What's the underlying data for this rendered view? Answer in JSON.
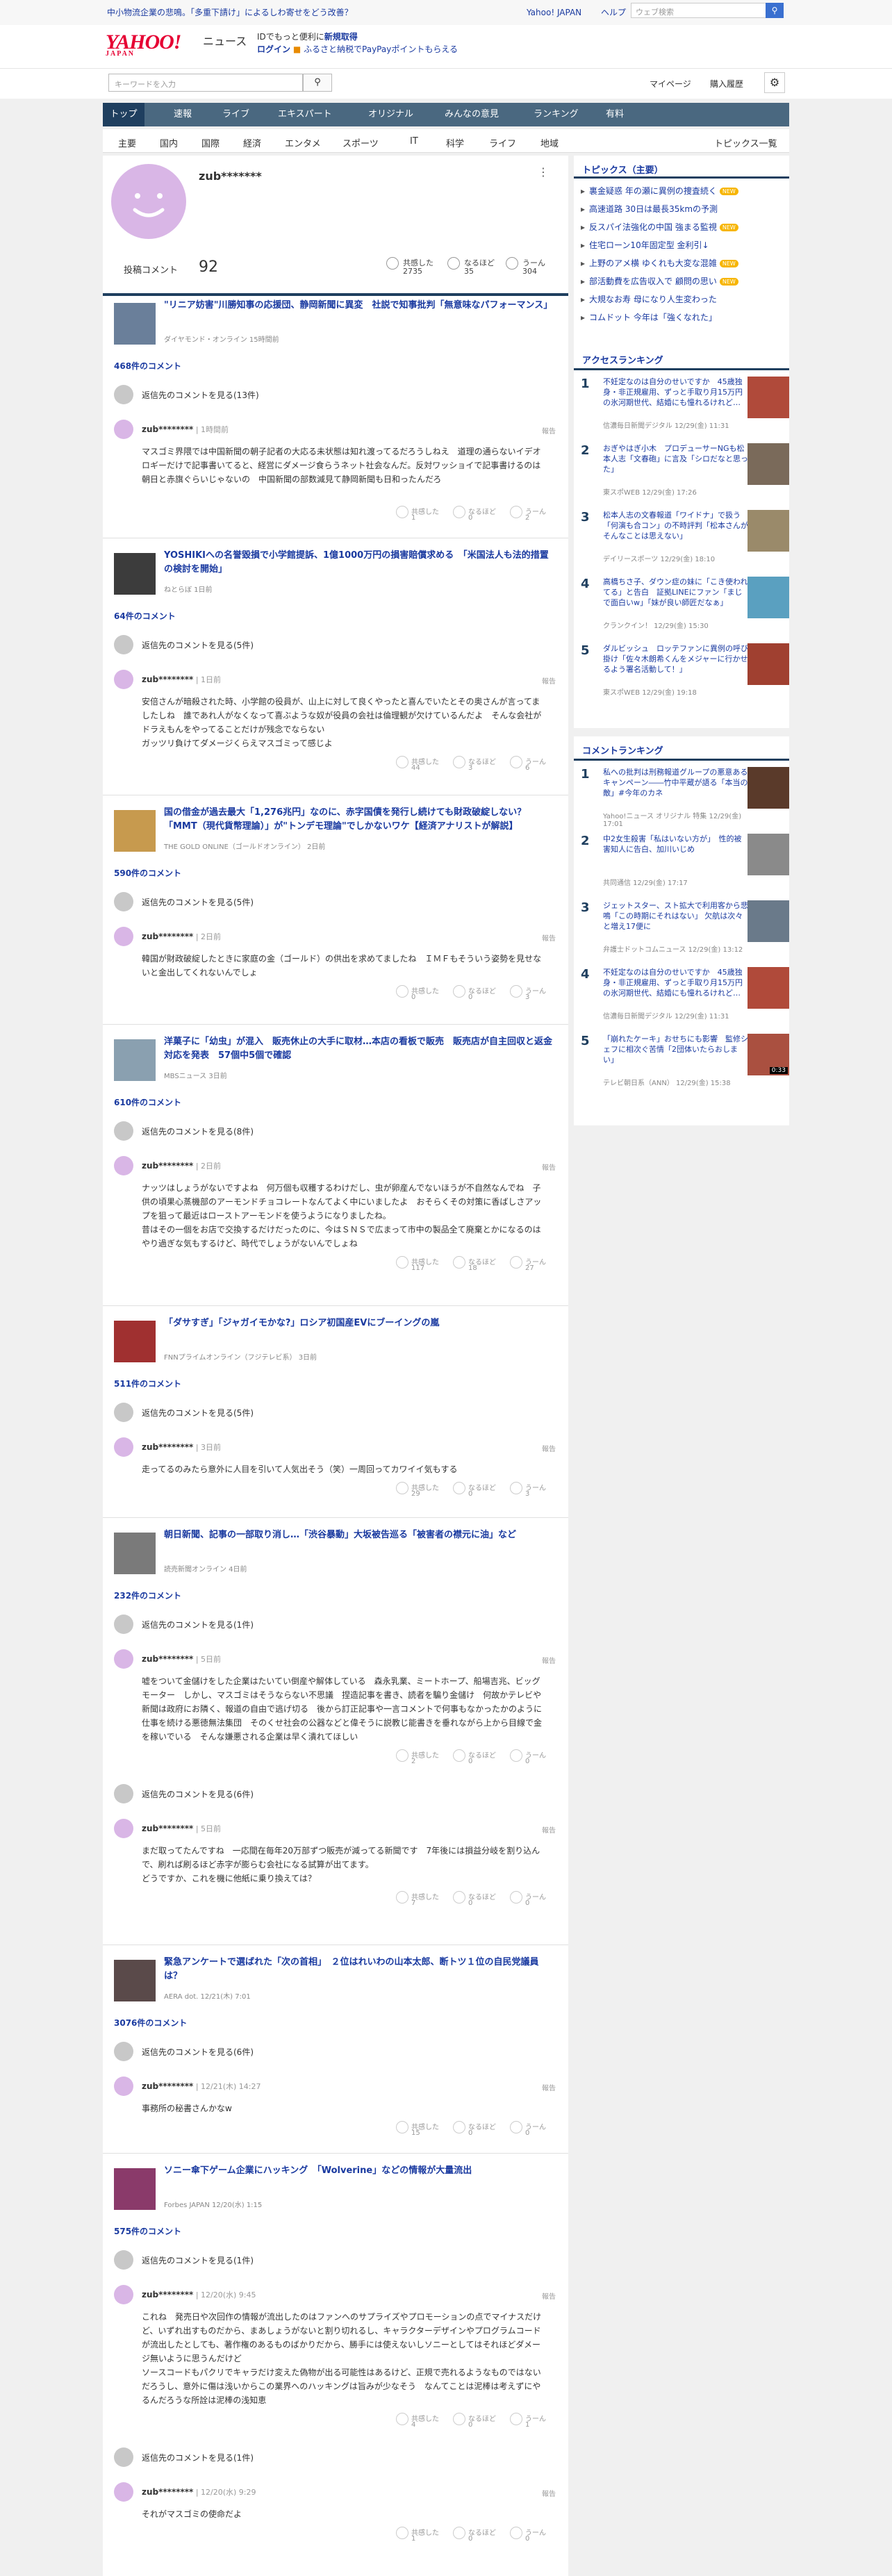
{
  "topbar": {
    "notice": "中小物流企業の悲鳴。「多重下請け」によるしわ寄せをどう改善？",
    "links": [
      "Yahoo! JAPAN",
      "ヘルプ"
    ],
    "search_placeholder": "ウェブ検索",
    "search_icon": "search-icon"
  },
  "header": {
    "logo": "YAHOO!",
    "logo_sub_small": "JAPAN",
    "service": "ニュース",
    "promo_line1_text": "IDでもっと便利に",
    "promo_line1_link": "新規取得",
    "promo_line2_login": "ログイン",
    "promo_line2_text": "ふるさと納税でPayPayポイントもらえる",
    "keyword_placeholder": "キーワードを入力",
    "mypage": "マイページ",
    "history": "購入履歴",
    "gear_icon": "gear-icon"
  },
  "nav": [
    "トップ",
    "速報",
    "ライブ",
    "エキスパート",
    "オリジナル",
    "みんなの意見",
    "ランキング",
    "有料"
  ],
  "subnav": [
    "主要",
    "国内",
    "国際",
    "経済",
    "エンタメ",
    "スポーツ",
    "IT",
    "科学",
    "ライフ",
    "地域"
  ],
  "subnav_right": "トピックス一覧",
  "profile": {
    "username": "zub*******",
    "comment_label": "投稿コメント",
    "comment_count": "92",
    "stats": [
      {
        "label": "共感した",
        "value": "2735"
      },
      {
        "label": "なるほど",
        "value": "35"
      },
      {
        "label": "うーん",
        "value": "304"
      }
    ]
  },
  "labels": {
    "report": "報告",
    "agree": "共感した",
    "naruhodo": "なるほど",
    "uun": "うーん"
  },
  "articles": [
    {
      "title": "\"リニア妨害\"川勝知事の応援団、静岡新聞に異変　社説で知事批判「無意味なパフォーマンス」",
      "source": "ダイヤモンド・オンライン 15時間前",
      "comment_count": "468件のコメント",
      "reply": "返信先のコメントを見る(13件)",
      "user": "zub********",
      "date": "1時間前",
      "text": "マスゴミ界隈では中国新聞の朝子記者の大応る未状態は知れ渡ってるだろうしねえ　道理の通らないイデオロギーだけで記事書いてると、経営にダメージ食らうネット社会なんだ。反対ワッショイで記事書けるのは朝日と赤旗ぐらいじゃないの　中国新聞の部数減見て静岡新聞も日和ったんだろ",
      "reactions": [
        "1",
        "0",
        "2"
      ]
    },
    {
      "title": "YOSHIKIへの名誉毀損で小学館提訴、1億1000万円の損害賠償求める　「米国法人も法的措置の検討を開始」",
      "source": "ねとらぼ 1日前",
      "comment_count": "64件のコメント",
      "reply": "返信先のコメントを見る(5件)",
      "user": "zub********",
      "date": "1日前",
      "text": "安倍さんが暗殺された時、小学館の役員が、山上に対して良くやったと喜んでいたとその奥さんが言ってましたしね　誰であれ人がなくなって喜ぶような奴が役員の会社は倫理観が欠けているんだよ　そんな会社がドラえもんをやってることだけが残念でならない\nガッツリ負けてダメージくらえマスゴミって感じよ",
      "reactions": [
        "44",
        "3",
        "6"
      ]
    },
    {
      "title": "国の借金が過去最大「1,276兆円」なのに、赤字国債を発行し続けても財政破綻しない？「MMT（現代貨幣理論）」が\"トンデモ理論\"でしかないワケ【経済アナリストが解説】",
      "source": "THE GOLD ONLINE（ゴールドオンライン） 2日前",
      "comment_count": "590件のコメント",
      "reply": "返信先のコメントを見る(5件)",
      "user": "zub********",
      "date": "2日前",
      "text": "韓国が財政破綻したときに家庭の金（ゴールド）の供出を求めてましたね　ＩＭＦもそういう姿勢を見せないと金出してくれないんでしょ",
      "reactions": [
        "0",
        "0",
        "3"
      ]
    },
    {
      "title": "洋菓子に「幼虫」が混入　販売休止の大手に取材…本店の看板で販売　販売店が自主回収と返金対応を発表　57個中5個で確認",
      "source": "MBSニュース 3日前",
      "comment_count": "610件のコメント",
      "reply": "返信先のコメントを見る(8件)",
      "user": "zub********",
      "date": "2日前",
      "text": "ナッツはしょうがないですよね　何万個も収穫するわけだし、虫が卵産んでないほうが不自然なんでね　子供の頃果心蒸機部のアーモンドチョコレートなんてよく中にいましたよ　おそらくその対策に香ばしさアップを狙って最近はローストアーモンドを使うようになりましたね。\n昔はその一個をお店で交換するだけだったのに、今はＳＮＳで広まって市中の製品全て廃棄とかになるのはやり過ぎな気もするけど、時代でしょうがないんでしょね",
      "reactions": [
        "117",
        "18",
        "27"
      ]
    },
    {
      "title": "「ダサすぎ」「ジャガイモかな?」ロシア初国産EVにブーイングの嵐",
      "source": "FNNプライムオンライン（フジテレビ系） 3日前",
      "comment_count": "511件のコメント",
      "reply": "返信先のコメントを見る(5件)",
      "user": "zub********",
      "date": "3日前",
      "text": "走ってるのみたら意外に人目を引いて人気出そう（笑）一周回ってカワイイ気もする",
      "reactions": [
        "29",
        "0",
        "3"
      ]
    },
    {
      "title": "朝日新聞、記事の一部取り消し…「渋谷暴動」大坂被告巡る「被害者の襟元に油」など",
      "source": "読売新聞オンライン 4日前",
      "comment_count": "232件のコメント",
      "reply": "返信先のコメントを見る(1件)",
      "user": "zub********",
      "date": "5日前",
      "text": "嘘をついて金儲けをした企業はたいてい倒産や解体している　森永乳業、ミートホープ、船場吉兆、ビッグモーター　しかし、マスゴミはそうならない不思議　捏造記事を書き、読者を騙り金儲け　何故かテレビや新聞は政府にお隣く、報道の自由で逃げ切る　後から訂正記事や一言コメントで何事もなかったかのように仕事を続ける悪徳無法集団　そのくせ社会の公器などと偉そうに説教じ能書きを垂れながら上から目線で金を稼いでいる　そんな嫌悪される企業は早く潰れてほしい",
      "reactions": [
        "2",
        "0",
        "0"
      ],
      "extra": {
        "reply": "返信先のコメントを見る(6件)",
        "user": "zub********",
        "date": "5日前",
        "text": "まだ取ってたんですね　一応間在毎年20万部ずつ販売が減ってる新聞です　7年後には損益分岐を割り込んで、刷れば刷るほど赤字が膨らむ会社になる試算が出てます。\nどうですか、これを機に他紙に乗り換えては？",
        "reactions": [
          "7",
          "0",
          "0"
        ]
      }
    },
    {
      "title": "緊急アンケートで選ばれた「次の首相」　２位はれいわの山本太郎、断トツ１位の自民党議員は？",
      "source": "AERA dot. 12/21(木) 7:01",
      "comment_count": "3076件のコメント",
      "reply": "返信先のコメントを見る(6件)",
      "user": "zub********",
      "date": "12/21(木) 14:27",
      "text": "事務所の秘書さんかなw",
      "reactions": [
        "15",
        "0",
        "0"
      ]
    },
    {
      "title": "ソニー傘下ゲーム企業にハッキング　「Wolverine」などの情報が大量流出",
      "source": "Forbes JAPAN 12/20(水) 1:15",
      "comment_count": "575件のコメント",
      "reply": "返信先のコメントを見る(1件)",
      "user": "zub********",
      "date": "12/20(水) 9:45",
      "text": "これね　発売日や次回作の情報が流出したのはファンへのサプライズやプロモーションの点でマイナスだけど、いずれ出すものだから、まあしょうがないと割り切れるし、キャラクターデザインやプログラムコードが流出したとしても、著作権のあるものばかりだから、勝手には使えないしソニーとしてはそれほどダメージ無いように思うんだけど\nソースコードもパクリでキャラだけ変えた偽物が出る可能性はあるけど、正規で売れるようなものではないだろうし、意外に傷は浅いからこの業界へのハッキングは旨みが少なそう　なんてことは泥棒は考えずにやるんだろうな所詮は泥棒の浅知恵",
      "reactions": [
        "4",
        "0",
        "1"
      ],
      "extra": {
        "reply": "返信先のコメントを見る(1件)",
        "user": "zub********",
        "date": "12/20(水) 9:29",
        "text": "それがマスゴミの使命だよ",
        "reactions": [
          "1",
          "0",
          "0"
        ]
      }
    }
  ],
  "sidebar": {
    "topics_title": "トピックス（主要）",
    "topics": [
      {
        "text": "裏金疑惑 年の瀬に異例の捜査続く",
        "new": true
      },
      {
        "text": "高速道路 30日は最長35kmの予測",
        "new": false
      },
      {
        "text": "反スパイ法強化の中国 強まる監視",
        "new": true
      },
      {
        "text": "住宅ローン10年固定型 金利引↓",
        "new": false
      },
      {
        "text": "上野のアメ横 ゆくれも大変な混雑",
        "new": true
      },
      {
        "text": "部活動費を広告収入で 顧問の思い",
        "new": true
      },
      {
        "text": "大規なお寿 母になり人生変わった",
        "new": false
      },
      {
        "text": "コムドット 今年は「強くなれた」",
        "new": false
      }
    ],
    "new_badge": "NEW",
    "access_title": "アクセスランキング",
    "access": [
      {
        "n": "1",
        "t": "不妊定なのは自分のせいですか　45歳独身・非正規雇用、ずっと手取り月15万円の氷河期世代、結婚にも憧れるけれど…",
        "s": "信濃毎日新聞デジタル 12/29(金) 11:31"
      },
      {
        "n": "2",
        "t": "おぎやはぎ小木　プロデューサーNGも松本人志「文春砲」に言及「シロだなと思った」",
        "s": "東スポWEB 12/29(金) 17:26"
      },
      {
        "n": "3",
        "t": "松本人志の文春報道「ワイドナ」で扱う　「何演も合コン」の不時評判「松本さんがそんなことは思えない」",
        "s": "デイリースポーツ 12/29(金) 18:10"
      },
      {
        "n": "4",
        "t": "高橋ちさ子、ダウン症の妹に「こき使われてる」と告白　証拠LINEにファン「まじで面白いw」「妹が良い師匠だなぁ」",
        "s": "クランクイン！ 12/29(金) 15:30"
      },
      {
        "n": "5",
        "t": "ダルビッシュ　ロッテファンに異例の呼び掛け「佐々木朗希くんをメジャーに行かせるよう署名活動して！」",
        "s": "東スポWEB 12/29(金) 19:18"
      }
    ],
    "comment_title": "コメントランキング",
    "comment": [
      {
        "n": "1",
        "t": "私への批判は刑務報道グループの悪意あるキャンペーン――竹中平蔵が語る「本当の敵」#今年のカネ",
        "s": "Yahoo!ニュース オリジナル 特集 12/29(金) 17:01"
      },
      {
        "n": "2",
        "t": "中2女生殺害「私はいない方が」　性的被害知人に告白、加川いじめ",
        "s": "共同通信 12/29(金) 17:17"
      },
      {
        "n": "3",
        "t": "ジェットスター、スト拡大で利用客から悲鳴「この時期にそれはない」 欠航は次々と増え17便に",
        "s": "弁護士ドットコムニュース 12/29(金) 13:12"
      },
      {
        "n": "4",
        "t": "不妊定なのは自分のせいですか　45歳独身・非正規雇用、ずっと手取り月15万円の氷河期世代、結婚にも憧れるけれど…",
        "s": "信濃毎日新聞デジタル 12/29(金) 11:31"
      },
      {
        "n": "5",
        "t": "「崩れたケーキ」おせちにも影響　監修シェフに相次ぐ苦情「2団体いたらおしまい」",
        "s": "テレビ朝日系（ANN） 12/29(金) 15:38"
      }
    ],
    "video_time": "0:33"
  }
}
